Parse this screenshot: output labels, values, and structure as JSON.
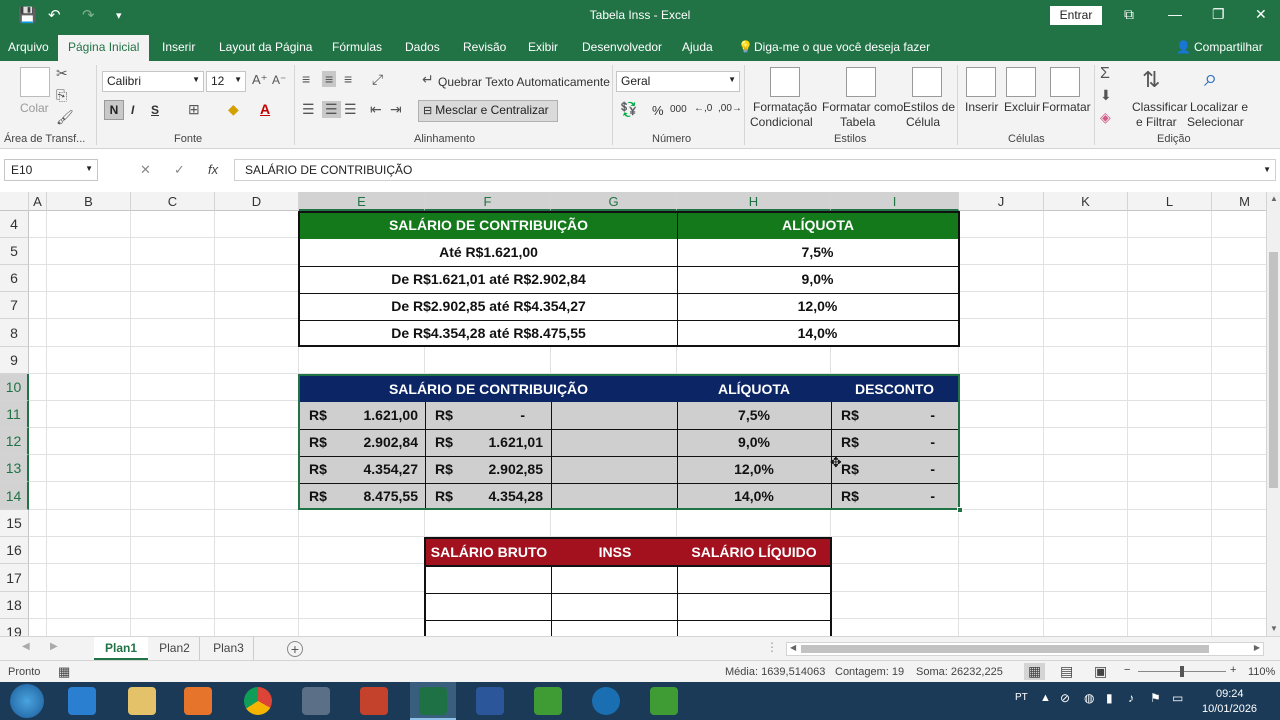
{
  "window": {
    "title": "Tabela Inss  -  Excel",
    "sign_in": "Entrar",
    "qa_save": "💾",
    "qa_undo": "↶",
    "qa_redo": "↷",
    "qa_more": "▾",
    "win_options": "⧉",
    "win_minimize": "—",
    "win_restore": "❐",
    "win_close": "✕"
  },
  "menu": {
    "tabs": [
      "Arquivo",
      "Página Inicial",
      "Inserir",
      "Layout da Página",
      "Fórmulas",
      "Dados",
      "Revisão",
      "Exibir",
      "Desenvolvedor",
      "Ajuda"
    ],
    "tell_me": "Diga-me o que você deseja fazer",
    "share": "Compartilhar"
  },
  "ribbon": {
    "paste": "Colar",
    "clipboard_group": "Área de Transf...",
    "font_name": "Calibri",
    "font_size": "12",
    "bold": "N",
    "italic": "I",
    "underline": "S",
    "font_group": "Fonte",
    "wrap_text": "Quebrar Texto Automaticamente",
    "merge_center": "Mesclar e Centralizar",
    "alignment_group": "Alinhamento",
    "number_format": "Geral",
    "number_group": "Número",
    "cond_format": [
      "Formatação",
      "Condicional"
    ],
    "format_table": [
      "Formatar como",
      "Tabela"
    ],
    "cell_styles": [
      "Estilos de",
      "Célula"
    ],
    "styles_group": "Estilos",
    "insert": "Inserir",
    "delete": "Excluir",
    "format": "Formatar",
    "cells_group": "Células",
    "sort_filter": [
      "Classificar",
      "e Filtrar"
    ],
    "find_select": [
      "Localizar e",
      "Selecionar"
    ],
    "editing_group": "Edição"
  },
  "formula_bar": {
    "name_box": "E10",
    "fx_label": "fx",
    "formula": "SALÁRIO DE CONTRIBUIÇÃO"
  },
  "grid": {
    "columns": [
      "A",
      "B",
      "C",
      "D",
      "E",
      "F",
      "G",
      "H",
      "I",
      "J",
      "K",
      "L",
      "M"
    ],
    "rows": [
      "4",
      "5",
      "6",
      "7",
      "8",
      "9",
      "10",
      "11",
      "12",
      "13",
      "14",
      "15",
      "16",
      "17",
      "18",
      "19"
    ]
  },
  "table1": {
    "header": [
      "SALÁRIO DE CONTRIBUIÇÃO",
      "ALÍQUOTA"
    ],
    "rows": [
      [
        "Até R$1.621,00",
        "7,5%"
      ],
      [
        "De R$1.621,01 até R$2.902,84",
        "9,0%"
      ],
      [
        "De R$2.902,85 até R$4.354,27",
        "12,0%"
      ],
      [
        "De R$4.354,28 até R$8.475,55",
        "14,0%"
      ]
    ]
  },
  "table2": {
    "header": [
      "SALÁRIO DE CONTRIBUIÇÃO",
      "ALÍQUOTA",
      "DESCONTO"
    ],
    "currency": "R$",
    "rows": [
      [
        "1.621,00",
        "-",
        "7,5%",
        "-"
      ],
      [
        "2.902,84",
        "1.621,01",
        "9,0%",
        "-"
      ],
      [
        "4.354,27",
        "2.902,85",
        "12,0%",
        "-"
      ],
      [
        "8.475,55",
        "4.354,28",
        "14,0%",
        "-"
      ]
    ]
  },
  "table3": {
    "header": [
      "SALÁRIO BRUTO",
      "INSS",
      "SALÁRIO LÍQUIDO"
    ]
  },
  "sheets": {
    "tabs": [
      "Plan1",
      "Plan2",
      "Plan3"
    ],
    "add": "+"
  },
  "status": {
    "ready": "Pronto",
    "average": "Média: 1639,514063",
    "count": "Contagem: 19",
    "sum": "Soma: 26232,225",
    "zoom": "110%"
  },
  "taskbar": {
    "lang": "PT",
    "time": "09:24",
    "date": "10/01/2026"
  },
  "colors": {
    "excel_green": "#217346",
    "table1_header": "#13791a",
    "table2_header": "#0b2565",
    "table3_header": "#a3101e",
    "table2_fill": "#cfcfcf"
  }
}
